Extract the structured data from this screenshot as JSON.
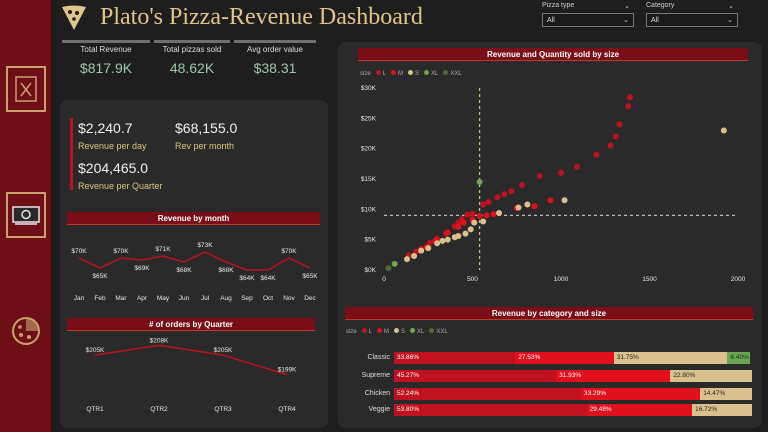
{
  "title": "Plato's Pizza-Revenue Dashboard",
  "slicers": [
    {
      "label": "Pizza type",
      "value": "All"
    },
    {
      "label": "Category",
      "value": "All"
    }
  ],
  "kpis": [
    {
      "label": "Total Revenue",
      "value": "$817.9K"
    },
    {
      "label": "Total pizzas sold",
      "value": "48.62K"
    },
    {
      "label": "Avg order value",
      "value": "$38.31"
    }
  ],
  "stats": [
    {
      "value": "$2,240.7",
      "label": "Revenue per day"
    },
    {
      "value": "$68,155.0",
      "label": "Rev per month"
    },
    {
      "value": "$204,465.0",
      "label": "Revenue per Quarter"
    }
  ],
  "colors": {
    "L": "#c0121e",
    "M": "#e0111c",
    "S": "#d9c08c",
    "XL": "#6aa84f",
    "XXL": "#4e6b2f"
  },
  "revenue_by_month": {
    "title": "Revenue by month",
    "months": [
      "Jan",
      "Feb",
      "Mar",
      "Apr",
      "May",
      "Jun",
      "Jul",
      "Aug",
      "Sep",
      "Oct",
      "Nov",
      "Dec"
    ],
    "values": [
      70,
      65,
      70,
      69,
      71,
      68,
      73,
      68,
      64,
      64,
      70,
      65
    ],
    "labels": [
      "$70K",
      "$65K",
      "$70K",
      "$69K",
      "$71K",
      "$68K",
      "$73K",
      "$68K",
      "$64K",
      "$64K",
      "$70K",
      "$65K"
    ]
  },
  "orders_by_quarter": {
    "title": "# of orders by Quarter",
    "quarters": [
      "QTR1",
      "QTR2",
      "QTR3",
      "QTR4"
    ],
    "values": [
      205,
      208,
      205,
      199
    ],
    "labels": [
      "$205K",
      "$208K",
      "$205K",
      "$199K"
    ]
  },
  "chart_data": {
    "type": "scatter",
    "title": "Revenue and Quantity sold by size",
    "legend_title": "size",
    "legend": [
      "L",
      "M",
      "S",
      "XL",
      "XXL"
    ],
    "xlim": [
      0,
      2000
    ],
    "ylim": [
      0,
      30000
    ],
    "xticks": [
      "0",
      "500",
      "1000",
      "1500",
      "2000"
    ],
    "yticks": [
      "$0K",
      "$5K",
      "$10K",
      "$15K",
      "$20K",
      "$25K",
      "$30K"
    ],
    "ref_x": 540,
    "ref_y": 9000,
    "series": [
      {
        "name": "L",
        "points": [
          [
            1390,
            28500
          ],
          [
            1380,
            27000
          ],
          [
            1330,
            24000
          ],
          [
            1310,
            22000
          ],
          [
            1280,
            20500
          ],
          [
            1200,
            19000
          ],
          [
            1090,
            17000
          ],
          [
            1000,
            16000
          ],
          [
            880,
            15500
          ],
          [
            780,
            14000
          ],
          [
            720,
            13000
          ],
          [
            680,
            12500
          ],
          [
            640,
            12000
          ],
          [
            590,
            11200
          ],
          [
            560,
            10800
          ],
          [
            500,
            9300
          ],
          [
            470,
            9100
          ],
          [
            440,
            8400
          ],
          [
            420,
            7800
          ],
          [
            400,
            7200
          ],
          [
            350,
            6000
          ],
          [
            300,
            5200
          ],
          [
            260,
            4500
          ],
          [
            210,
            3500
          ],
          [
            180,
            3000
          ],
          [
            140,
            2400
          ]
        ]
      },
      {
        "name": "M",
        "points": [
          [
            940,
            11500
          ],
          [
            850,
            10500
          ],
          [
            750,
            10200
          ],
          [
            620,
            9200
          ],
          [
            580,
            9000
          ],
          [
            540,
            8900
          ],
          [
            500,
            8300
          ],
          [
            450,
            7800
          ],
          [
            420,
            7100
          ],
          [
            360,
            6200
          ],
          [
            290,
            4800
          ],
          [
            240,
            3800
          ]
        ]
      },
      {
        "name": "S",
        "points": [
          [
            1920,
            23000
          ],
          [
            1020,
            11500
          ],
          [
            810,
            10800
          ],
          [
            760,
            10300
          ],
          [
            650,
            9400
          ],
          [
            560,
            8000
          ],
          [
            510,
            7800
          ],
          [
            490,
            6700
          ],
          [
            460,
            6000
          ],
          [
            420,
            5600
          ],
          [
            400,
            5400
          ],
          [
            360,
            5000
          ],
          [
            330,
            4800
          ],
          [
            300,
            4400
          ],
          [
            250,
            3600
          ],
          [
            210,
            3200
          ],
          [
            170,
            2300
          ],
          [
            130,
            1800
          ]
        ]
      },
      {
        "name": "XL",
        "points": [
          [
            540,
            14500
          ],
          [
            60,
            1000
          ]
        ]
      },
      {
        "name": "XXL",
        "points": [
          [
            25,
            300
          ]
        ]
      }
    ]
  },
  "revenue_by_category": {
    "title": "Revenue by category and size",
    "legend_title": "size",
    "legend": [
      "L",
      "M",
      "S",
      "XL",
      "XXL"
    ],
    "rows": [
      {
        "name": "Classic",
        "segments": [
          {
            "size": "L",
            "value": 33.86,
            "label": "33.86%"
          },
          {
            "size": "M",
            "value": 27.53,
            "label": "27.53%"
          },
          {
            "size": "S",
            "value": 31.75,
            "label": "31.75%"
          },
          {
            "size": "XL",
            "value": 6.4,
            "label": "6.40%"
          }
        ]
      },
      {
        "name": "Supreme",
        "segments": [
          {
            "size": "L",
            "value": 45.27,
            "label": "45.27%"
          },
          {
            "size": "M",
            "value": 31.93,
            "label": "31.93%"
          },
          {
            "size": "S",
            "value": 22.8,
            "label": "22.80%"
          }
        ]
      },
      {
        "name": "Chicken",
        "segments": [
          {
            "size": "L",
            "value": 52.24,
            "label": "52.24%"
          },
          {
            "size": "M",
            "value": 33.29,
            "label": "33.29%"
          },
          {
            "size": "S",
            "value": 14.47,
            "label": "14.47%"
          }
        ]
      },
      {
        "name": "Veggie",
        "segments": [
          {
            "size": "L",
            "value": 53.8,
            "label": "53.80%"
          },
          {
            "size": "M",
            "value": 29.48,
            "label": "29.48%"
          },
          {
            "size": "S",
            "value": 16.72,
            "label": "16.72%"
          }
        ]
      }
    ]
  }
}
